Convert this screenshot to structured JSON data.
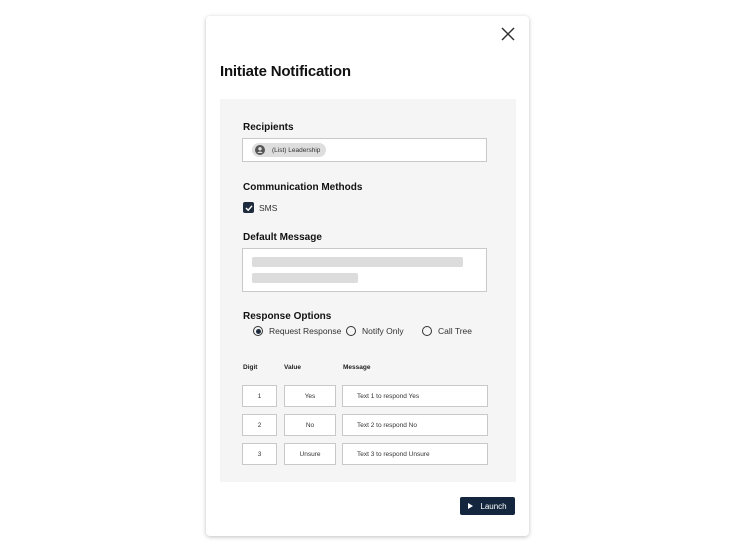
{
  "dialog": {
    "title": "Initiate Notification",
    "close_icon": "close-icon"
  },
  "recipients": {
    "label": "Recipients",
    "chip": "(List) Leadership",
    "chip_icon": "person-icon"
  },
  "communication_methods": {
    "label": "Communication Methods",
    "options": [
      {
        "label": "SMS",
        "checked": true
      }
    ]
  },
  "default_message": {
    "label": "Default Message"
  },
  "response_options": {
    "label": "Response Options",
    "options": [
      {
        "label": "Request Response",
        "selected": true
      },
      {
        "label": "Notify Only",
        "selected": false
      },
      {
        "label": "Call Tree",
        "selected": false
      }
    ]
  },
  "table": {
    "headers": {
      "digit": "Digit",
      "value": "Value",
      "message": "Message"
    },
    "rows": [
      {
        "digit": "1",
        "value": "Yes",
        "message": "Text 1 to respond Yes"
      },
      {
        "digit": "2",
        "value": "No",
        "message": "Text 2 to respond No"
      },
      {
        "digit": "3",
        "value": "Unsure",
        "message": "Text 3 to respond Unsure"
      }
    ]
  },
  "footer": {
    "launch_label": "Launch",
    "launch_icon": "play-icon"
  },
  "colors": {
    "primary": "#13263d",
    "panel_bg": "#f5f5f5",
    "border": "#c9c9c9"
  }
}
